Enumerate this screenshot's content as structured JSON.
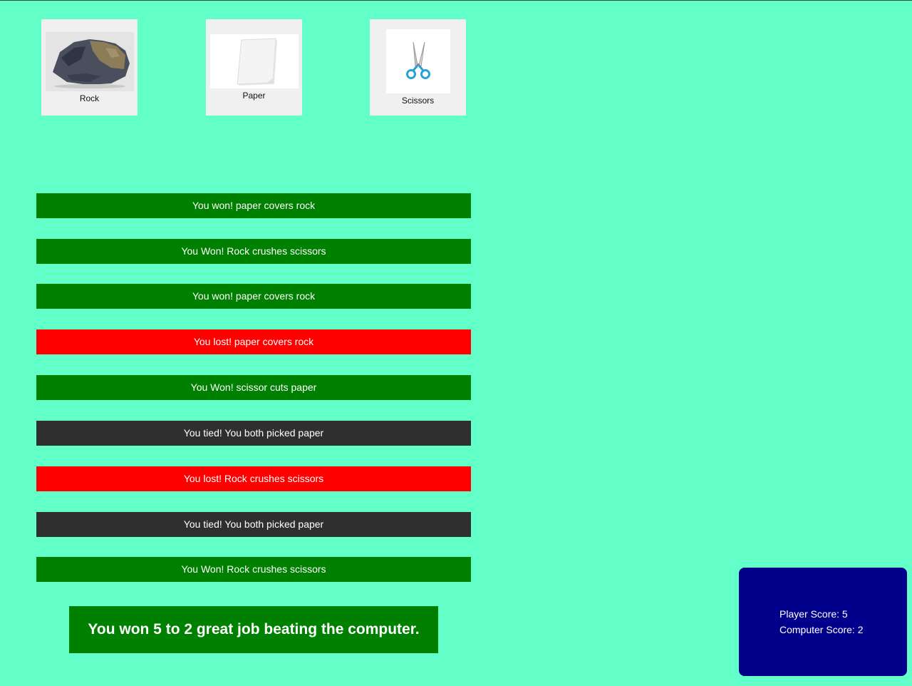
{
  "choices": [
    {
      "label": "Rock"
    },
    {
      "label": "Paper"
    },
    {
      "label": "Scissors"
    }
  ],
  "results": [
    {
      "text": "You won! paper covers rock",
      "outcome": "win"
    },
    {
      "text": "You Won! Rock crushes scissors",
      "outcome": "win"
    },
    {
      "text": "You won! paper covers rock",
      "outcome": "win"
    },
    {
      "text": "You lost! paper covers rock",
      "outcome": "lose"
    },
    {
      "text": "You Won! scissor cuts paper",
      "outcome": "win"
    },
    {
      "text": "You tied! You both picked paper",
      "outcome": "tie"
    },
    {
      "text": "You lost! Rock crushes scissors",
      "outcome": "lose"
    },
    {
      "text": "You tied! You both picked paper",
      "outcome": "tie"
    },
    {
      "text": "You Won! Rock crushes scissors",
      "outcome": "win"
    }
  ],
  "final_message": "You won 5 to 2 great job beating the computer.",
  "scoreboard": {
    "player_label": "Player Score: 5",
    "computer_label": "Computer Score: 2"
  },
  "colors": {
    "background": "#63ffc9",
    "win": "#008000",
    "lose": "#ff0000",
    "tie": "#2f2f2f",
    "scoreboard": "#00008b"
  }
}
